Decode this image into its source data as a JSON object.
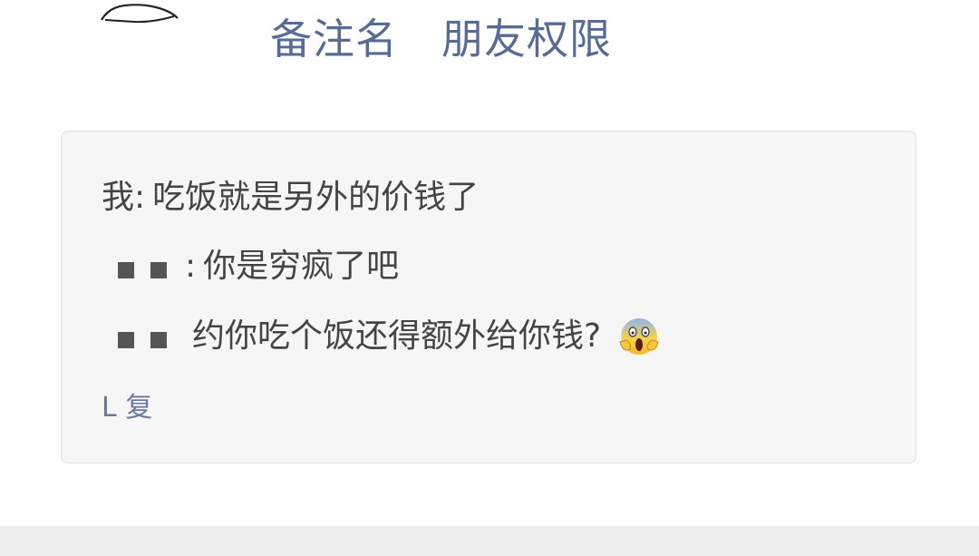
{
  "actions": {
    "remark_label": "备注名",
    "permissions_label": "朋友权限"
  },
  "comments": {
    "line1_speaker": "我:",
    "line1_text": "吃饭就是另外的价钱了",
    "line2_speaker_suffix": ":",
    "line2_text": "你是穷疯了吧",
    "line3_text": "约你吃个饭还得额外给你钱?",
    "line3_emoji": "screaming-face-emoji",
    "line4_link": "L 复"
  },
  "colors": {
    "link_blue": "#576b95",
    "box_bg": "#f6f6f6",
    "text_gray": "#444444"
  }
}
